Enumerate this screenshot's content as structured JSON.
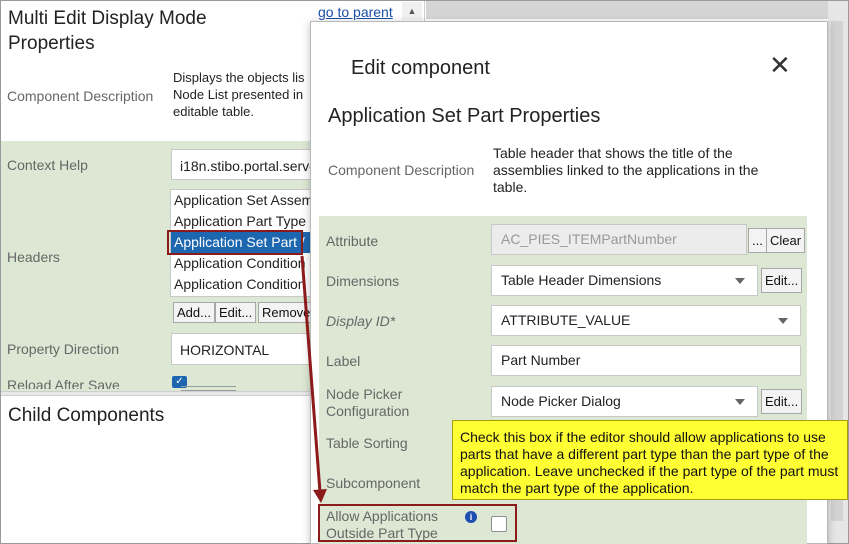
{
  "back_panel": {
    "title": "Multi Edit Display Mode Properties",
    "goto_parent": "go to parent",
    "component_description_label": "Component Description",
    "component_description_lines": [
      "Displays the objects lis",
      "Node List presented in",
      "editable table."
    ],
    "context_help_label": "Context Help",
    "context_help_value": "i18n.stibo.portal.serve",
    "headers_label": "Headers",
    "headers_options": [
      "Application Set Assem",
      "Application Part Type",
      "Application Set Part /",
      "Application Condition",
      "Application Condition"
    ],
    "headers_selected_index": 2,
    "buttons": {
      "add": "Add...",
      "edit": "Edit...",
      "remove": "Remove"
    },
    "property_direction_label": "Property Direction",
    "property_direction_value": "HORIZONTAL",
    "reload_after_save_label": "Reload After Save",
    "child_components_title": "Child Components"
  },
  "dialog": {
    "title": "Edit component",
    "close_glyph": "✕",
    "heading": "Application Set Part Properties",
    "component_description_label": "Component Description",
    "component_description_text": "Table header that shows the title of the assemblies linked to the applications in the table.",
    "fields": {
      "attribute": {
        "label": "Attribute",
        "value": "AC_PIES_ITEMPartNumber",
        "btn_more": "...",
        "btn_clear": "Clear"
      },
      "dimensions": {
        "label": "Dimensions",
        "value": "Table Header Dimensions",
        "btn_edit": "Edit..."
      },
      "display_id": {
        "label": "Display ID*",
        "value": "ATTRIBUTE_VALUE"
      },
      "label": {
        "label": "Label",
        "value": "Part Number"
      },
      "node_picker": {
        "label": "Node Picker Configuration",
        "value": "Node Picker Dialog",
        "btn_edit": "Edit..."
      },
      "table_sorting": {
        "label": "Table Sorting"
      },
      "subcomponent": {
        "label": "Subcomponent"
      },
      "allow_applications": {
        "label": "Allow Applications Outside Part Type",
        "info_glyph": "i",
        "checked": false
      }
    }
  },
  "tooltip": {
    "text": "Check this box if the editor should allow applications to use parts that have a different part type than the part type of the application. Leave unchecked if the part type of the part must match the part type of the application."
  },
  "colors": {
    "panel_green": "#dde8d4",
    "selection_blue": "#1d67b1",
    "tooltip_yellow": "#ffff33",
    "highlight_red": "#8b1a1a",
    "link_blue": "#1a4fa8"
  }
}
